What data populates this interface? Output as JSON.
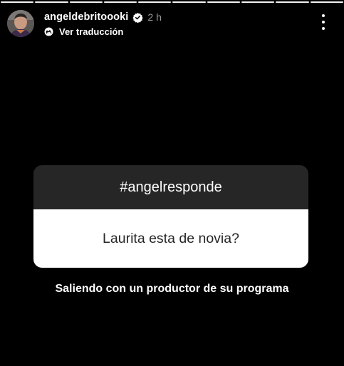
{
  "story": {
    "segments_total": 10,
    "segments_done": 10
  },
  "header": {
    "username": "angeldebritoooki",
    "time": "2 h",
    "translate_label": "Ver traducción",
    "verified_icon": "verified-badge-icon",
    "more_icon": "more-vertical-icon"
  },
  "question_sticker": {
    "hashtag": "#angelresponde",
    "question": "Laurita esta de novia?"
  },
  "answer": {
    "text": "Saliendo con un productor de su programa"
  },
  "colors": {
    "background": "#000000",
    "card_header": "#262626",
    "card_body": "#ffffff",
    "card_text": "#262626"
  }
}
